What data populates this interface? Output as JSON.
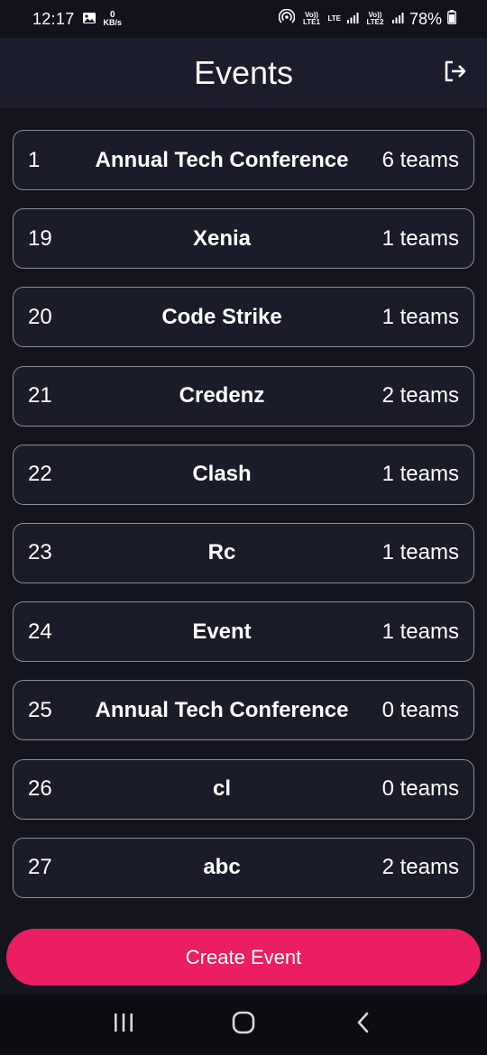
{
  "status_bar": {
    "time": "12:17",
    "speed_value": "0",
    "speed_unit": "KB/s",
    "sim1_label": "Vo)) LTE1",
    "lte_label": "LTE",
    "sim2_label": "Vo)) LTE2",
    "battery": "78%",
    "icons": [
      "gallery-icon",
      "hotspot-icon",
      "signal-icon",
      "battery-icon"
    ]
  },
  "header": {
    "title": "Events",
    "logout_icon": "logout-icon"
  },
  "events": [
    {
      "id": "1",
      "name": "Annual Tech Conference",
      "teams": "6 teams"
    },
    {
      "id": "19",
      "name": "Xenia",
      "teams": "1 teams"
    },
    {
      "id": "20",
      "name": "Code Strike",
      "teams": "1 teams"
    },
    {
      "id": "21",
      "name": "Credenz",
      "teams": "2 teams"
    },
    {
      "id": "22",
      "name": "Clash",
      "teams": "1 teams"
    },
    {
      "id": "23",
      "name": "Rc",
      "teams": "1 teams"
    },
    {
      "id": "24",
      "name": "Event",
      "teams": "1 teams"
    },
    {
      "id": "25",
      "name": "Annual Tech Conference",
      "teams": "0 teams"
    },
    {
      "id": "26",
      "name": "cl",
      "teams": "0 teams"
    },
    {
      "id": "27",
      "name": "abc",
      "teams": "2 teams"
    }
  ],
  "create_button": {
    "label": "Create Event",
    "color": "#e91e63"
  },
  "nav": {
    "icons": [
      "recent-apps-icon",
      "home-icon",
      "back-icon"
    ]
  },
  "colors": {
    "background": "#14141f",
    "header": "#1b1c2c",
    "card": "#1b1c2a",
    "card_border": "#8a8d9a",
    "accent": "#e91e63"
  }
}
